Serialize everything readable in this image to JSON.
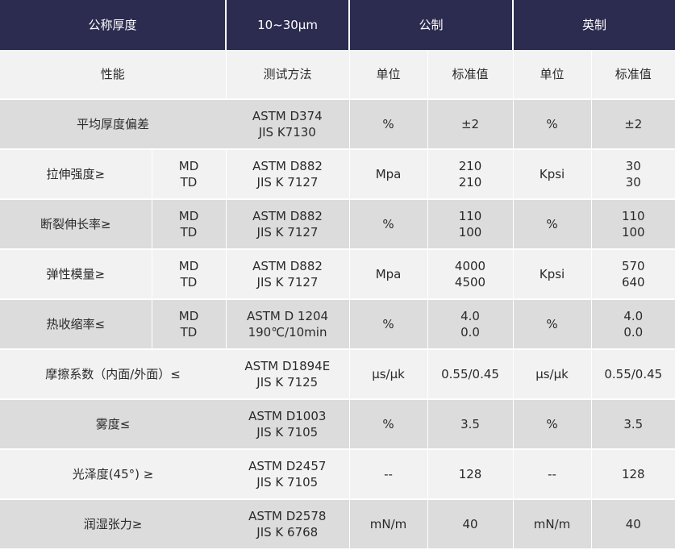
{
  "header": {
    "col1": "公称厚度",
    "col2": "10~30μm",
    "metric": "公制",
    "imperial": "英制"
  },
  "subheader": {
    "property": "性能",
    "method": "测试方法",
    "unit": "单位",
    "standard": "标准值",
    "unit2": "单位",
    "standard2": "标准值"
  },
  "rows": [
    {
      "name": "平均厚度偏差",
      "dir": [
        "",
        ""
      ],
      "method": [
        "ASTM D374",
        "JIS K7130"
      ],
      "unit_m": "%",
      "val_m": [
        "±2",
        ""
      ],
      "unit_i": "%",
      "val_i": [
        "±2",
        ""
      ]
    },
    {
      "name": "拉伸强度≥",
      "dir": [
        "MD",
        "TD"
      ],
      "method": [
        "ASTM D882",
        "JIS K 7127"
      ],
      "unit_m": "Mpa",
      "val_m": [
        "210",
        "210"
      ],
      "unit_i": "Kpsi",
      "val_i": [
        "30",
        "30"
      ]
    },
    {
      "name": "断裂伸长率≥",
      "dir": [
        "MD",
        "TD"
      ],
      "method": [
        "ASTM D882",
        "JIS K 7127"
      ],
      "unit_m": "%",
      "val_m": [
        "110",
        "100"
      ],
      "unit_i": "%",
      "val_i": [
        "110",
        "100"
      ]
    },
    {
      "name": "弹性模量≥",
      "dir": [
        "MD",
        "TD"
      ],
      "method": [
        "ASTM D882",
        "JIS K 7127"
      ],
      "unit_m": "Mpa",
      "val_m": [
        "4000",
        "4500"
      ],
      "unit_i": "Kpsi",
      "val_i": [
        "570",
        "640"
      ]
    },
    {
      "name": "热收缩率≤",
      "dir": [
        "MD",
        "TD"
      ],
      "method": [
        "ASTM D 1204",
        "190℃/10min"
      ],
      "unit_m": "%",
      "val_m": [
        "4.0",
        "0.0"
      ],
      "unit_i": "%",
      "val_i": [
        "4.0",
        "0.0"
      ]
    },
    {
      "name": "摩擦系数（内面/外面）≤",
      "dir": [
        "",
        ""
      ],
      "method": [
        "ASTM D1894E",
        "JIS K 7125"
      ],
      "unit_m": "μs/μk",
      "val_m": [
        "0.55/0.45",
        ""
      ],
      "unit_i": "μs/μk",
      "val_i": [
        "0.55/0.45",
        ""
      ]
    },
    {
      "name": "雾度≤",
      "dir": [
        "",
        ""
      ],
      "method": [
        "ASTM D1003",
        "JIS K 7105"
      ],
      "unit_m": "%",
      "val_m": [
        "3.5",
        ""
      ],
      "unit_i": "%",
      "val_i": [
        "3.5",
        ""
      ]
    },
    {
      "name": "光泽度(45°) ≥",
      "dir": [
        "",
        ""
      ],
      "method": [
        "ASTM D2457",
        "JIS K 7105"
      ],
      "unit_m": "--",
      "val_m": [
        "128",
        ""
      ],
      "unit_i": "--",
      "val_i": [
        "128",
        ""
      ]
    },
    {
      "name": "润湿张力≥",
      "dir": [
        "",
        ""
      ],
      "method": [
        "ASTM D2578",
        "JIS K 6768"
      ],
      "unit_m": "mN/m",
      "val_m": [
        "40",
        ""
      ],
      "unit_i": "mN/m",
      "val_i": [
        "40",
        ""
      ]
    }
  ],
  "colors": {
    "header_bg": "#2c2b50",
    "row_gray": "#dcdcdd",
    "row_light": "#f2f2f3"
  }
}
